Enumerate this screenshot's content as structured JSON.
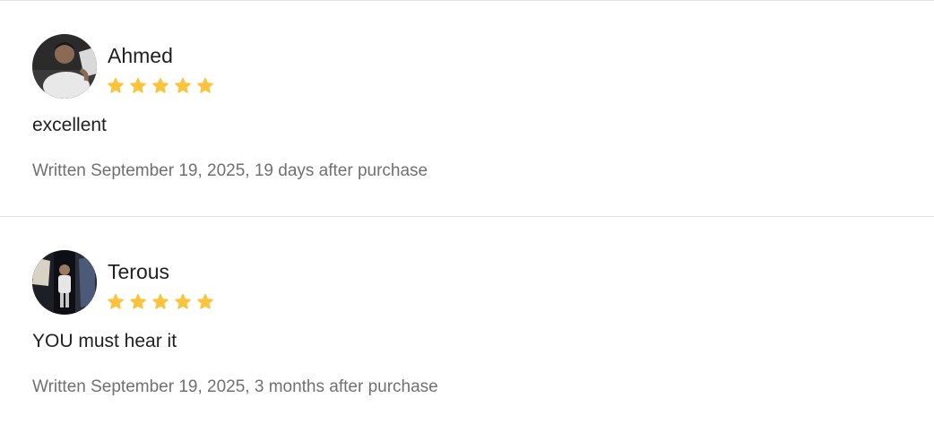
{
  "star_color": "#fcc33c",
  "reviews": [
    {
      "author": "Ahmed",
      "rating": 5,
      "text": "excellent",
      "meta": "Written September 19, 2025, 19 days after purchase"
    },
    {
      "author": "Terous",
      "rating": 5,
      "text": "YOU must hear it",
      "meta": "Written September 19, 2025, 3 months after purchase"
    }
  ]
}
